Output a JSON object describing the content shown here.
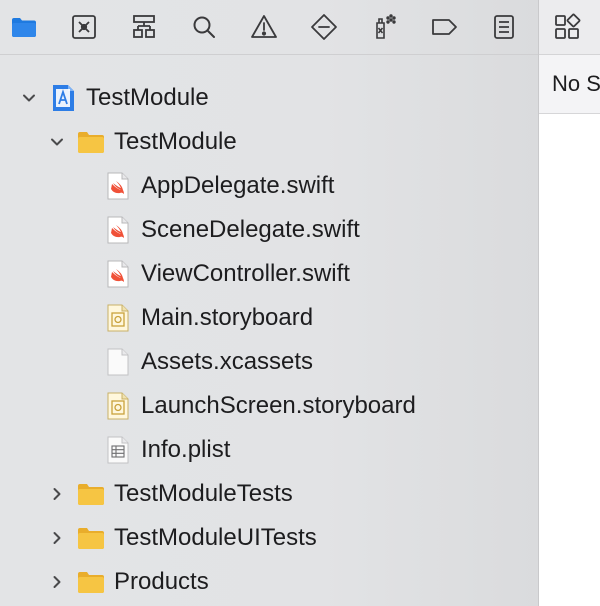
{
  "navigator": {
    "toolbar": [
      {
        "icon": "folder-icon",
        "active": true
      },
      {
        "icon": "source-control-icon"
      },
      {
        "icon": "symbol-hierarchy-icon"
      },
      {
        "icon": "search-icon"
      },
      {
        "icon": "warning-icon"
      },
      {
        "icon": "test-diamond-icon"
      },
      {
        "icon": "debug-spray-icon"
      },
      {
        "icon": "breakpoint-tag-icon"
      },
      {
        "icon": "report-list-icon"
      }
    ],
    "tree": [
      {
        "label": "TestModule",
        "type": "project",
        "level": 0,
        "expanded": true
      },
      {
        "label": "TestModule",
        "type": "folder",
        "level": 1,
        "expanded": true
      },
      {
        "label": "AppDelegate.swift",
        "type": "swift",
        "level": 2
      },
      {
        "label": "SceneDelegate.swift",
        "type": "swift",
        "level": 2
      },
      {
        "label": "ViewController.swift",
        "type": "swift",
        "level": 2
      },
      {
        "label": "Main.storyboard",
        "type": "storyboard",
        "level": 2
      },
      {
        "label": "Assets.xcassets",
        "type": "blank",
        "level": 2
      },
      {
        "label": "LaunchScreen.storyboard",
        "type": "storyboard",
        "level": 2
      },
      {
        "label": "Info.plist",
        "type": "plist",
        "level": 2
      },
      {
        "label": "TestModuleTests",
        "type": "folder",
        "level": 1,
        "expanded": false
      },
      {
        "label": "TestModuleUITests",
        "type": "folder",
        "level": 1,
        "expanded": false
      },
      {
        "label": "Products",
        "type": "folder",
        "level": 1,
        "expanded": false
      }
    ]
  },
  "inspector": {
    "no_selection_label": "No Selection"
  },
  "colors": {
    "accent": "#1f7ae0",
    "folder": "#f5c242",
    "swift": "#f05138",
    "icon_gray": "#3a3a3c"
  }
}
